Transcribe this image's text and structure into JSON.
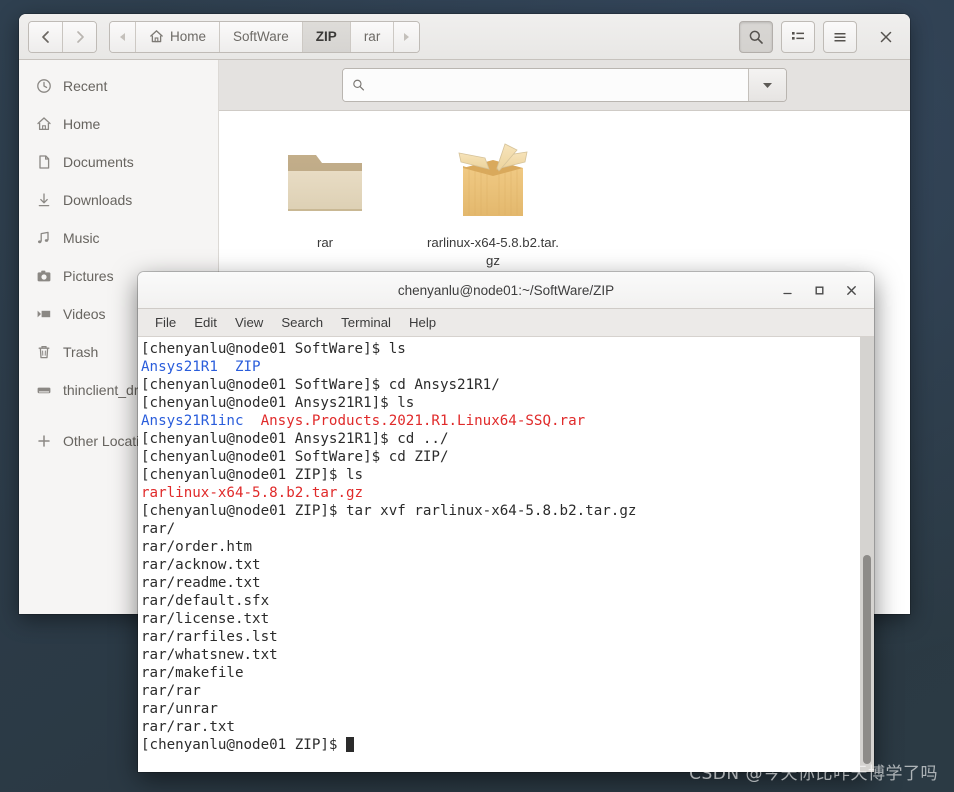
{
  "file_manager": {
    "nav": {
      "back_icon": "chevron-left-icon",
      "forward_icon": "chevron-right-icon"
    },
    "breadcrumb": {
      "overflow_left_icon": "triangle-left-icon",
      "overflow_right_icon": "triangle-right-icon",
      "items": [
        {
          "label": "Home",
          "icon": "home-icon",
          "active": false
        },
        {
          "label": "SoftWare",
          "icon": "",
          "active": false
        },
        {
          "label": "ZIP",
          "icon": "",
          "active": true
        },
        {
          "label": "rar",
          "icon": "",
          "active": false
        }
      ]
    },
    "toolbar": {
      "search_icon": "search-icon",
      "view_list_icon": "list-view-icon",
      "menu_icon": "hamburger-menu-icon",
      "close_icon": "close-icon"
    },
    "sidebar": {
      "items": [
        {
          "label": "Recent",
          "icon": "clock-icon"
        },
        {
          "label": "Home",
          "icon": "home-icon"
        },
        {
          "label": "Documents",
          "icon": "document-icon"
        },
        {
          "label": "Downloads",
          "icon": "download-arrow-icon"
        },
        {
          "label": "Music",
          "icon": "music-note-icon"
        },
        {
          "label": "Pictures",
          "icon": "camera-icon"
        },
        {
          "label": "Videos",
          "icon": "video-icon"
        },
        {
          "label": "Trash",
          "icon": "trash-icon"
        },
        {
          "label": "thinclient_drives",
          "icon": "drive-icon"
        }
      ],
      "other_locations": {
        "label": "Other Locations",
        "icon": "plus-icon"
      }
    },
    "search": {
      "value": "",
      "placeholder": "",
      "icon": "search-icon",
      "dropdown_icon": "triangle-down-icon"
    },
    "files": [
      {
        "name": "rar",
        "type": "folder",
        "icon": "folder-icon"
      },
      {
        "name": "rarlinux-x64-5.8.b2.tar.gz",
        "type": "archive",
        "icon": "archive-box-icon"
      }
    ]
  },
  "terminal": {
    "title": "chenyanlu@node01:~/SoftWare/ZIP",
    "window_buttons": {
      "minimize_icon": "minimize-icon",
      "maximize_icon": "maximize-icon",
      "close_icon": "close-icon"
    },
    "menus": [
      "File",
      "Edit",
      "View",
      "Search",
      "Terminal",
      "Help"
    ],
    "colors": {
      "directory": "#2a5ddb",
      "archive": "#e02a2a",
      "text": "#2b2b2b",
      "background": "#ffffff"
    },
    "lines": [
      [
        {
          "t": "[chenyanlu@node01 SoftWare]$ ls",
          "c": "plain"
        }
      ],
      [
        {
          "t": "Ansys21R1",
          "c": "dir"
        },
        {
          "t": "  ",
          "c": "plain"
        },
        {
          "t": "ZIP",
          "c": "dir"
        }
      ],
      [
        {
          "t": "[chenyanlu@node01 SoftWare]$ cd Ansys21R1/",
          "c": "plain"
        }
      ],
      [
        {
          "t": "[chenyanlu@node01 Ansys21R1]$ ls",
          "c": "plain"
        }
      ],
      [
        {
          "t": "Ansys21R1inc",
          "c": "dir"
        },
        {
          "t": "  ",
          "c": "plain"
        },
        {
          "t": "Ansys.Products.2021.R1.Linux64-SSQ.rar",
          "c": "arc"
        }
      ],
      [
        {
          "t": "[chenyanlu@node01 Ansys21R1]$ cd ../",
          "c": "plain"
        }
      ],
      [
        {
          "t": "[chenyanlu@node01 SoftWare]$ cd ZIP/",
          "c": "plain"
        }
      ],
      [
        {
          "t": "[chenyanlu@node01 ZIP]$ ls",
          "c": "plain"
        }
      ],
      [
        {
          "t": "rarlinux-x64-5.8.b2.tar.gz",
          "c": "arc"
        }
      ],
      [
        {
          "t": "[chenyanlu@node01 ZIP]$ tar xvf rarlinux-x64-5.8.b2.tar.gz",
          "c": "plain"
        }
      ],
      [
        {
          "t": "rar/",
          "c": "plain"
        }
      ],
      [
        {
          "t": "rar/order.htm",
          "c": "plain"
        }
      ],
      [
        {
          "t": "rar/acknow.txt",
          "c": "plain"
        }
      ],
      [
        {
          "t": "rar/readme.txt",
          "c": "plain"
        }
      ],
      [
        {
          "t": "rar/default.sfx",
          "c": "plain"
        }
      ],
      [
        {
          "t": "rar/license.txt",
          "c": "plain"
        }
      ],
      [
        {
          "t": "rar/rarfiles.lst",
          "c": "plain"
        }
      ],
      [
        {
          "t": "rar/whatsnew.txt",
          "c": "plain"
        }
      ],
      [
        {
          "t": "rar/makefile",
          "c": "plain"
        }
      ],
      [
        {
          "t": "rar/rar",
          "c": "plain"
        }
      ],
      [
        {
          "t": "rar/unrar",
          "c": "plain"
        }
      ],
      [
        {
          "t": "rar/rar.txt",
          "c": "plain"
        }
      ],
      [
        {
          "t": "[chenyanlu@node01 ZIP]$ ",
          "c": "plain"
        },
        {
          "t": "",
          "c": "cursor"
        }
      ]
    ]
  },
  "watermark": {
    "text": "CSDN @今天你比咋天博学了吗"
  }
}
